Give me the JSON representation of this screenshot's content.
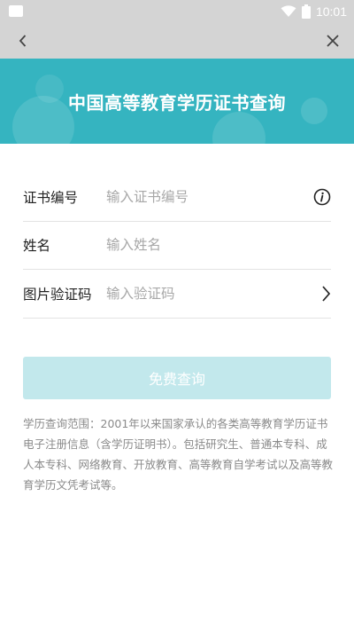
{
  "status_bar": {
    "time": "10:01"
  },
  "header": {
    "title": "中国高等教育学历证书查询",
    "accent_color": "#35b4c0"
  },
  "form": {
    "fields": [
      {
        "label": "证书编号",
        "placeholder": "输入证书编号",
        "trailing_icon": "info-icon"
      },
      {
        "label": "姓名",
        "placeholder": "输入姓名",
        "trailing_icon": ""
      },
      {
        "label": "图片验证码",
        "placeholder": "输入验证码",
        "trailing_icon": "chevron-right-icon"
      }
    ]
  },
  "submit": {
    "label": "免费查询"
  },
  "note": {
    "text": "学历查询范围：2001年以来国家承认的各类高等教育学历证书电子注册信息（含学历证明书）。包括研究生、普通本专科、成人本专科、网络教育、开放教育、高等教育自学考试以及高等教育学历文凭考试等。"
  }
}
